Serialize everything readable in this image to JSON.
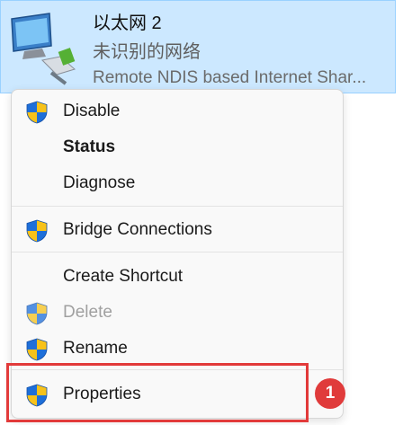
{
  "adapter": {
    "name": "以太网 2",
    "status": "未识别的网络",
    "device": "Remote NDIS based Internet Shar..."
  },
  "menu": {
    "items": [
      {
        "label": "Disable",
        "icon": "uac-shield-icon"
      },
      {
        "label": "Status",
        "bold": true
      },
      {
        "label": "Diagnose"
      },
      {
        "label": "Bridge Connections",
        "icon": "uac-shield-icon"
      },
      {
        "label": "Create Shortcut"
      },
      {
        "label": "Delete",
        "icon": "uac-shield-icon",
        "disabled": true
      },
      {
        "label": "Rename",
        "icon": "uac-shield-icon"
      },
      {
        "label": "Properties",
        "icon": "uac-shield-icon"
      }
    ]
  },
  "annotation": {
    "badge": "1",
    "highlight_color": "#e23a3a"
  }
}
